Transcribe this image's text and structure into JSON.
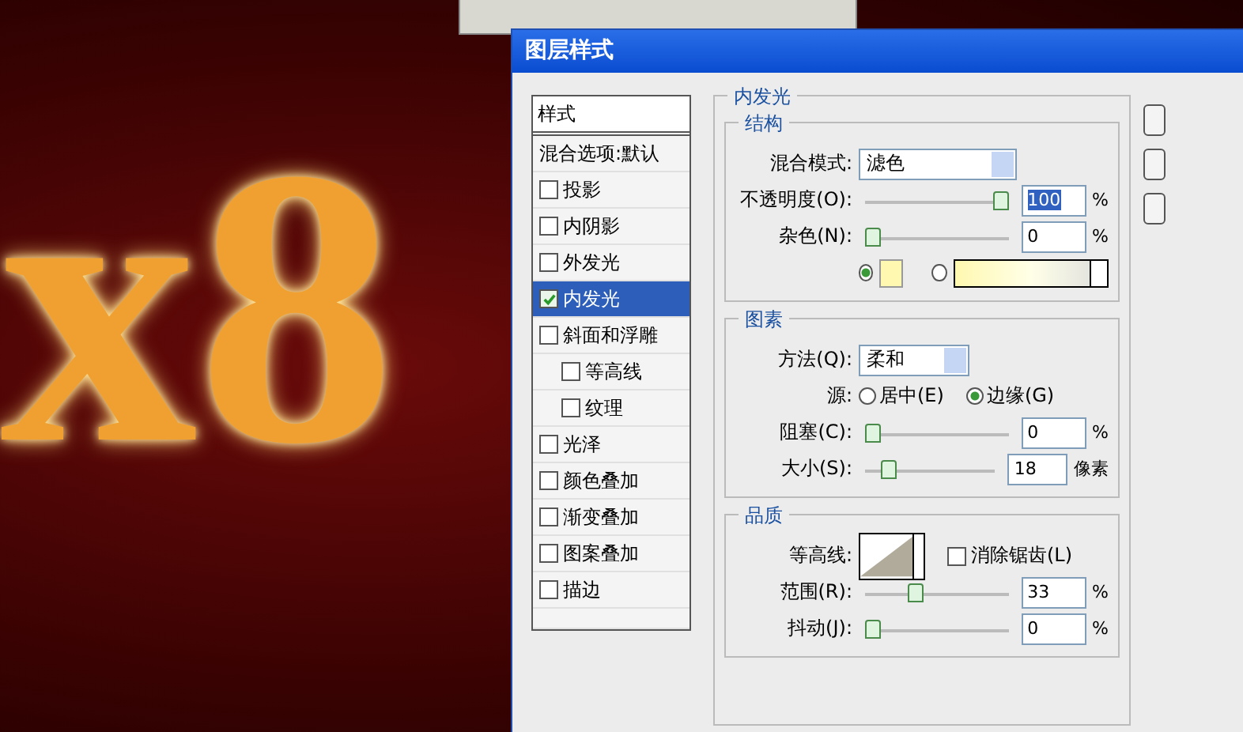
{
  "canvas": {
    "text": "x8"
  },
  "window": {
    "title": "图层样式"
  },
  "styles_list": {
    "header": "样式",
    "items": [
      {
        "label": "混合选项:默认",
        "kind": "plain",
        "selected": false
      },
      {
        "label": "投影",
        "kind": "check",
        "checked": false,
        "selected": false
      },
      {
        "label": "内阴影",
        "kind": "check",
        "checked": false,
        "selected": false
      },
      {
        "label": "外发光",
        "kind": "check",
        "checked": false,
        "selected": false
      },
      {
        "label": "内发光",
        "kind": "check",
        "checked": true,
        "selected": true
      },
      {
        "label": "斜面和浮雕",
        "kind": "check",
        "checked": false,
        "selected": false,
        "children": [
          {
            "label": "等高线",
            "kind": "check",
            "checked": false,
            "selected": false
          },
          {
            "label": "纹理",
            "kind": "check",
            "checked": false,
            "selected": false
          }
        ]
      },
      {
        "label": "光泽",
        "kind": "check",
        "checked": false,
        "selected": false
      },
      {
        "label": "颜色叠加",
        "kind": "check",
        "checked": false,
        "selected": false
      },
      {
        "label": "渐变叠加",
        "kind": "check",
        "checked": false,
        "selected": false
      },
      {
        "label": "图案叠加",
        "kind": "check",
        "checked": false,
        "selected": false
      },
      {
        "label": "描边",
        "kind": "check",
        "checked": false,
        "selected": false
      }
    ]
  },
  "panel": {
    "title": "内发光",
    "groups": [
      {
        "title": "结构",
        "rows": [
          {
            "kind": "select",
            "label": "混合模式:",
            "value": "滤色"
          },
          {
            "kind": "slider",
            "label": "不透明度(O):",
            "level": 1,
            "value": "100",
            "highlighted": true,
            "unit": "%"
          },
          {
            "kind": "slider",
            "label": "杂色(N):",
            "level": 0,
            "value": "0",
            "highlighted": false,
            "unit": "%"
          },
          {
            "kind": "fill",
            "options": [
              {
                "kind": "swatch",
                "selected": true
              },
              {
                "kind": "gradient",
                "selected": false
              }
            ]
          }
        ]
      },
      {
        "title": "图素",
        "rows": [
          {
            "kind": "select",
            "label": "方法(Q):",
            "value": "柔和"
          },
          {
            "kind": "radios",
            "label": "源:",
            "options": [
              {
                "label": "居中(E)",
                "selected": false
              },
              {
                "label": "边缘(G)",
                "selected": true
              }
            ]
          },
          {
            "kind": "slider",
            "label": "阻塞(C):",
            "level": 0,
            "value": "0",
            "highlighted": false,
            "unit": "%"
          },
          {
            "kind": "slider",
            "label": "大小(S):",
            "level": 0.14,
            "value": "18",
            "highlighted": false,
            "unit": "像素"
          }
        ]
      },
      {
        "title": "品质",
        "rows": [
          {
            "kind": "contour",
            "label": "等高线:",
            "checkbox": {
              "label": "消除锯齿(L)",
              "checked": false
            }
          },
          {
            "kind": "slider",
            "label": "范围(R):",
            "level": 0.33,
            "value": "33",
            "highlighted": false,
            "unit": "%"
          },
          {
            "kind": "slider",
            "label": "抖动(J):",
            "level": 0,
            "value": "0",
            "highlighted": false,
            "unit": "%"
          }
        ]
      }
    ]
  }
}
